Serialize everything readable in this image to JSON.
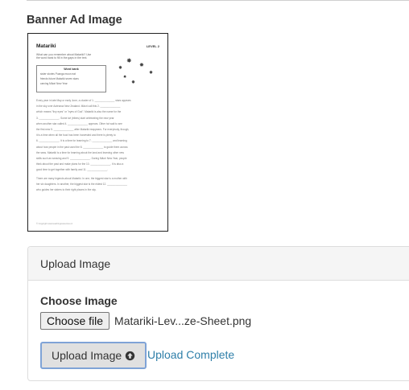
{
  "section": {
    "label": "Banner Ad Image"
  },
  "thumbnail": {
    "title": "Matariki",
    "level": "LEVEL 2",
    "instructions": [
      "What can you remember about Matariki? Use",
      "the word bank to fill in the gaps in the text."
    ],
    "word_bank_title": "Word bank",
    "word_bank_rows": [
      "sister    stories    Puanga    moon    eat",
      "friends    future    Matariki    seven    stars",
      "carving    Māori New Year"
    ],
    "paragraphs": [
      [
        "Every year in late May or early June, a cluster of 1. ______________ stars appears",
        "in the sky over Aotearoa New Zealand. Māori call this 2. ______________",
        "which means \"tiny eyes\" or \"eyes of God\". Matariki is also the name for the",
        "3. ______________. Some iwi (tribes) start celebrating the new year",
        "when another star called 4. ______________ appears. Other iwi wait to see",
        "the first new 5. ______________ after Matariki reappears. For everybody, though,",
        "it is a time when all the food has been harvested and there is plenty to",
        "6. ______________. It is a time for learning to 7. ______________ and learning",
        "about how people in the past used the 8. ______________ to guide them across",
        "the seas. Matariki is a time for learning about the land and learning other new",
        "skills such as weaving and 9. ______________. During Māori New Year, people",
        "think about the past and make plans for the 10. ______________. It is also a",
        "good time to get together with family and 11. ______________."
      ],
      [
        "There are many legends about Matariki. In one, the biggest star is a mother with",
        "her six daughters. In another, the biggest star is the eldest 12. ______________",
        "who guides her sisters to their right places in the sky."
      ]
    ],
    "footer": "© Copyright www.teachingresources.nz"
  },
  "upload_panel": {
    "title": "Upload Image",
    "choose_label": "Choose Image",
    "choose_button": "Choose file",
    "file_name": "Matariki-Lev...ze-Sheet.png",
    "upload_button": "Upload Image",
    "upload_icon": "circle-arrow-up-icon",
    "status_text": "Upload Complete"
  },
  "colors": {
    "status_link": "#2f7fa9",
    "upload_button_border": "#7fa3d6",
    "panel_heading_bg": "#f5f5f5"
  }
}
